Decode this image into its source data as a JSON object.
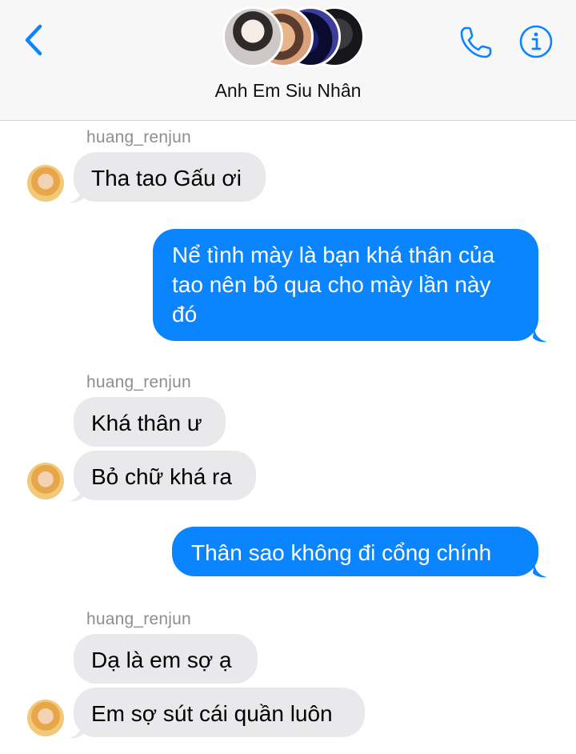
{
  "header": {
    "back_icon": "chevron-left-icon",
    "group_name": "Anh Em Siu Nhân",
    "phone_icon": "phone-icon",
    "info_icon": "info-icon",
    "accent_color": "#0b84ff"
  },
  "messages": [
    {
      "direction": "incoming",
      "sender": "huang_renjun",
      "text": "Tha tao Gấu ơi"
    },
    {
      "direction": "outgoing",
      "text": "Nể tình mày là bạn khá thân của tao nên bỏ qua cho mày lần này đó"
    },
    {
      "direction": "incoming",
      "sender": "huang_renjun",
      "text": "Khá thân ư"
    },
    {
      "direction": "incoming",
      "text": "Bỏ chữ khá ra"
    },
    {
      "direction": "outgoing",
      "text": "Thân sao không đi cổng chính"
    },
    {
      "direction": "incoming",
      "sender": "huang_renjun",
      "text": "Dạ là em sợ ạ"
    },
    {
      "direction": "incoming",
      "text": "Em sợ sút cái quần luôn"
    }
  ],
  "colors": {
    "incoming_bubble": "#e9e9eb",
    "outgoing_bubble": "#0b84ff",
    "sender_label": "#8e8e93"
  }
}
